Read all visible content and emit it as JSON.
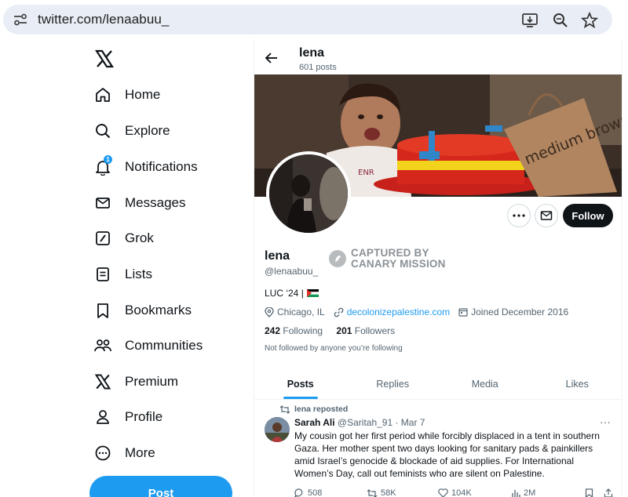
{
  "browser": {
    "url": "twitter.com/lenaabuu_",
    "icons": [
      "site-info-icon",
      "install-app-icon",
      "zoom-icon",
      "bookmark-star-icon"
    ]
  },
  "nav": {
    "items": [
      {
        "label": "Home",
        "icon": "home-icon"
      },
      {
        "label": "Explore",
        "icon": "search-icon"
      },
      {
        "label": "Notifications",
        "icon": "bell-icon",
        "badge": "1"
      },
      {
        "label": "Messages",
        "icon": "envelope-icon"
      },
      {
        "label": "Grok",
        "icon": "grok-icon"
      },
      {
        "label": "Lists",
        "icon": "list-icon"
      },
      {
        "label": "Bookmarks",
        "icon": "bookmark-icon"
      },
      {
        "label": "Communities",
        "icon": "communities-icon"
      },
      {
        "label": "Premium",
        "icon": "x-icon"
      },
      {
        "label": "Profile",
        "icon": "person-icon"
      },
      {
        "label": "More",
        "icon": "more-circle-icon"
      }
    ],
    "post_label": "Post"
  },
  "header": {
    "name": "lena",
    "posts": "601 posts"
  },
  "banner": {
    "bag_text": "medium brown bag"
  },
  "profile": {
    "name": "lena",
    "handle": "@lenaabuu_",
    "watermark": "CAPTURED BY CANARY MISSION",
    "bio": "LUC ‘24 |",
    "location": "Chicago, IL",
    "website": "decolonizepalestine.com",
    "joined": "Joined December 2016",
    "following_count": "242",
    "following_label": "Following",
    "followers_count": "201",
    "followers_label": "Followers",
    "not_followed": "Not followed by anyone you’re following",
    "follow_label": "Follow"
  },
  "tabs": [
    "Posts",
    "Replies",
    "Media",
    "Likes"
  ],
  "tweet": {
    "repost_label": "lena reposted",
    "author_name": "Sarah Ali",
    "author_handle": "@Saritah_91 · Mar 7",
    "text": "My cousin got her first period while forcibly displaced in a tent in southern Gaza. Her mother spent two days looking for sanitary pads & painkillers amid Israel’s genocide & blockade of aid supplies. For International Women’s Day, call out feminists who are silent on Palestine.",
    "replies": "508",
    "reposts": "58K",
    "likes": "104K",
    "views": "2M"
  },
  "colors": {
    "accent": "#1d9bf0",
    "text": "#0f1419",
    "muted": "#536471",
    "follow_button": "#0f1419"
  }
}
